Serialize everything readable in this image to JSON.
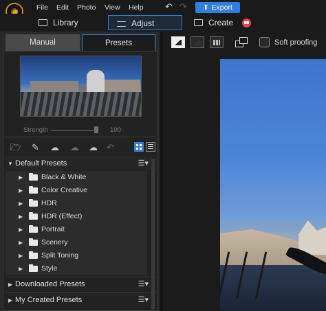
{
  "menu": {
    "file": "File",
    "edit": "Edit",
    "photo": "Photo",
    "view": "View",
    "help": "Help"
  },
  "toolbar": {
    "export_label": "Export"
  },
  "modules": {
    "library": "Library",
    "adjust": "Adjust",
    "create": "Create"
  },
  "panel_tabs": {
    "manual": "Manual",
    "presets": "Presets"
  },
  "strength": {
    "label": "Strength",
    "value": "100"
  },
  "groups": {
    "default": "Default Presets",
    "downloaded": "Downloaded Presets",
    "my_created": "My Created Presets"
  },
  "presets": [
    {
      "label": "Black & White"
    },
    {
      "label": "Color Creative"
    },
    {
      "label": "HDR"
    },
    {
      "label": "HDR (Effect)"
    },
    {
      "label": "Portrait"
    },
    {
      "label": "Scenery"
    },
    {
      "label": "Split Toning"
    },
    {
      "label": "Style"
    }
  ],
  "view_options": {
    "soft_proofing": "Soft proofing",
    "soft_proofing_checked": false
  },
  "colors": {
    "accent": "#3a7ec8",
    "export": "#2f7ee0",
    "create_badge": "#e04848",
    "panel": "#2a2a2a",
    "background": "#1b1b1b"
  }
}
